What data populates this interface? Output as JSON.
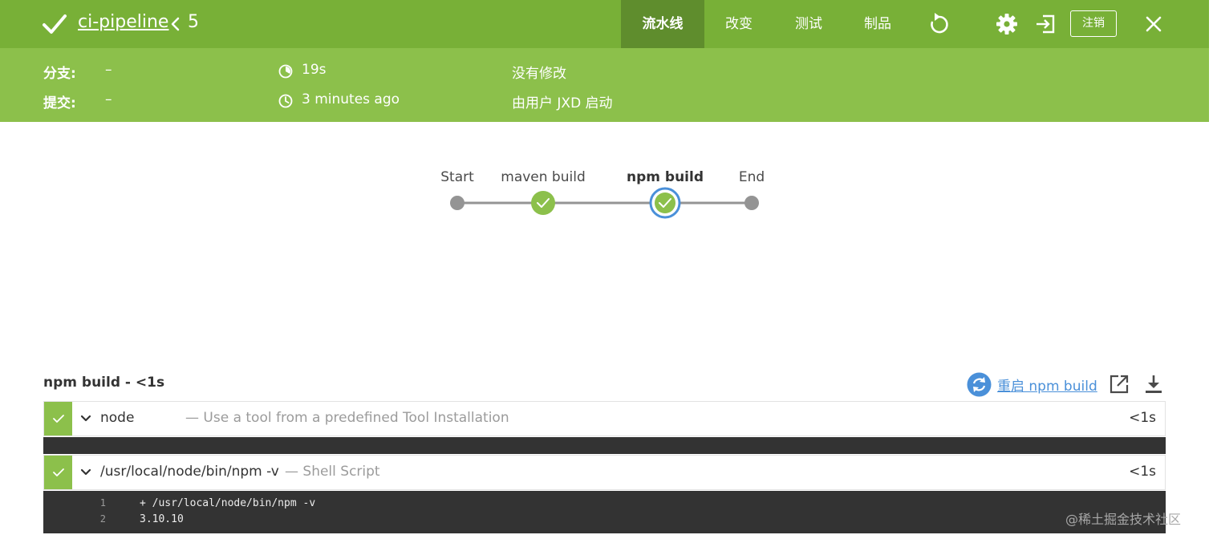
{
  "header": {
    "job_name": "ci-pipeline",
    "run_number": "5",
    "tabs": [
      {
        "label": "流水线",
        "active": true
      },
      {
        "label": "改变",
        "active": false
      },
      {
        "label": "测试",
        "active": false
      },
      {
        "label": "制品",
        "active": false
      }
    ],
    "logout_label": "注销",
    "icons": [
      "success-check-icon",
      "chevron-left-icon",
      "replay-icon",
      "gear-icon",
      "open-external-icon",
      "close-icon"
    ],
    "colors": {
      "bar": "#78b037",
      "active_tab": "#5f8d2d",
      "info_bar": "#8cc04b"
    }
  },
  "info": {
    "branch_label": "分支:",
    "branch_value": "–",
    "commit_label": "提交:",
    "commit_value": "–",
    "duration": "19s",
    "started": "3 minutes ago",
    "changes": "没有修改",
    "started_by": "由用户 JXD 启动"
  },
  "pipeline": {
    "stages": [
      {
        "label": "Start",
        "kind": "terminal"
      },
      {
        "label": "maven build",
        "kind": "success"
      },
      {
        "label": "npm build",
        "kind": "success",
        "selected": true
      },
      {
        "label": "End",
        "kind": "terminal"
      }
    ]
  },
  "stage_log": {
    "title": "npm build - <1s",
    "restart_label": "重启 npm build",
    "steps": [
      {
        "name": "node",
        "description": "— Use a tool from a predefined Tool Installation",
        "duration": "<1s",
        "status": "success",
        "lines": []
      },
      {
        "name": "/usr/local/node/bin/npm -v",
        "description": "— Shell Script",
        "duration": "<1s",
        "status": "success",
        "lines": [
          {
            "num": "1",
            "text": "+ /usr/local/node/bin/npm -v"
          },
          {
            "num": "2",
            "text": "3.10.10"
          }
        ]
      }
    ]
  },
  "watermark": "@稀土掘金技术社区"
}
